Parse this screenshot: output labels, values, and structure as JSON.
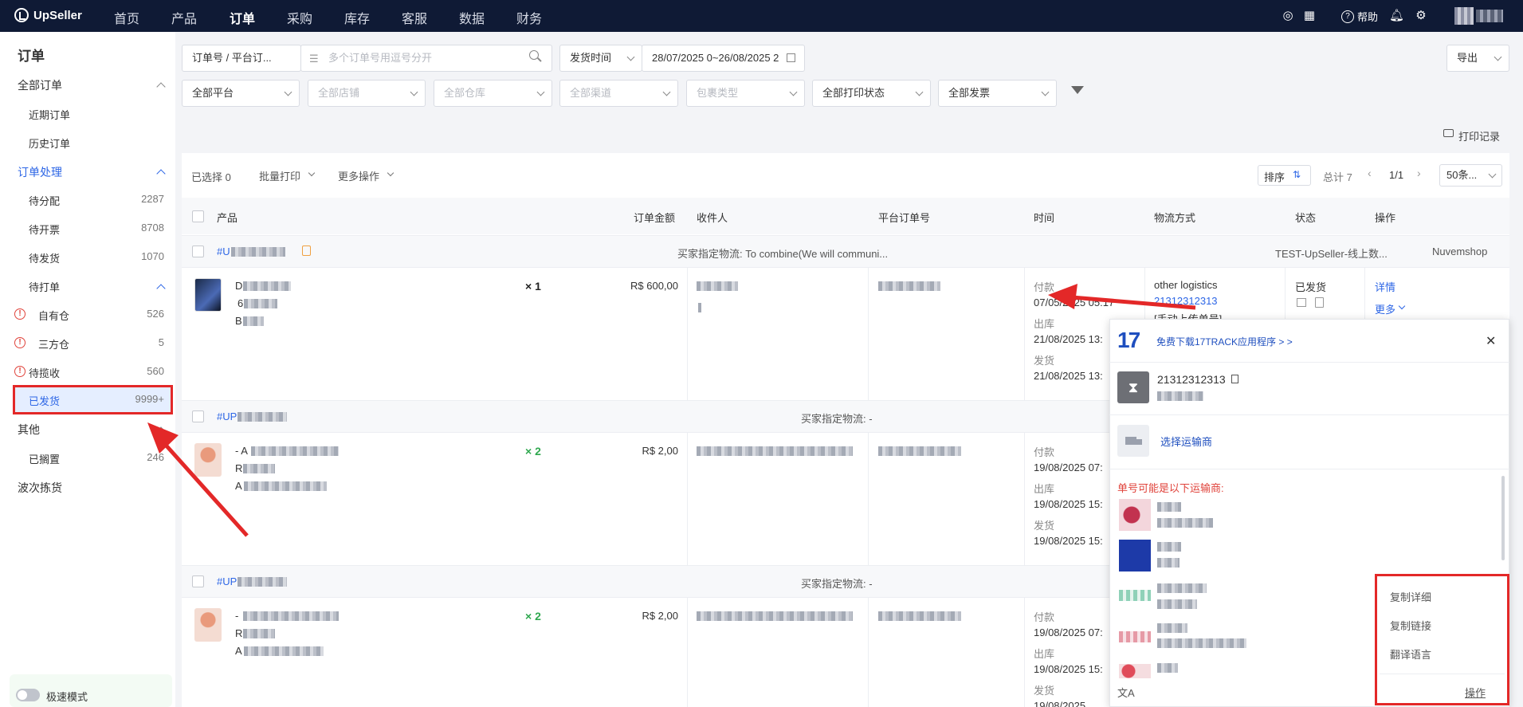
{
  "app": {
    "name": "UpSeller"
  },
  "nav": {
    "items": [
      "首页",
      "产品",
      "订单",
      "采购",
      "库存",
      "客服",
      "数据",
      "财务"
    ],
    "active": "订单",
    "help_label": "帮助"
  },
  "sidebar": {
    "title": "订单",
    "all_orders": "全部订单",
    "recent_orders": "近期订单",
    "history_orders": "历史订单",
    "processing": "订单处理",
    "pending_assign": {
      "label": "待分配",
      "count": "2287"
    },
    "pending_invoice": {
      "label": "待开票",
      "count": "8708"
    },
    "pending_ship": {
      "label": "待发货",
      "count": "1070"
    },
    "pending_print": "待打单",
    "own_warehouse": {
      "label": "自有仓",
      "count": "526"
    },
    "third_warehouse": {
      "label": "三方仓",
      "count": "5"
    },
    "pending_pickup": {
      "label": "待揽收",
      "count": "560"
    },
    "shipped": {
      "label": "已发货",
      "count": "9999+"
    },
    "other": "其他",
    "shelved": {
      "label": "已搁置",
      "count": "246"
    },
    "wave_picking": "波次拣货",
    "speed_mode": "极速模式"
  },
  "filters": {
    "order_type": "订单号 / 平台订...",
    "order_placeholder": "多个订单号用逗号分开",
    "time_type": "发货时间",
    "date_range": "28/07/2025 0~26/08/2025 2",
    "export": "导出",
    "platform": "全部平台",
    "shop": "全部店铺",
    "warehouse": "全部仓库",
    "channel": "全部渠道",
    "package_type": "包裹类型",
    "print_status": "全部打印状态",
    "invoice": "全部发票",
    "print_record": "打印记录"
  },
  "toolbar": {
    "selected": "已选择 0",
    "batch_print": "批量打印",
    "more_ops": "更多操作",
    "sort": "排序",
    "total": "总计 7",
    "page": "1/1",
    "page_size": "50条..."
  },
  "table": {
    "headers": [
      "产品",
      "订单金额",
      "收件人",
      "平台订单号",
      "时间",
      "物流方式",
      "状态",
      "操作"
    ]
  },
  "orders": [
    {
      "order_no": "#U",
      "buyer_logistics": "买家指定物流: To combine(We will communi...",
      "store": "TEST-UpSeller-线上数...",
      "platform": "Nuvemshop",
      "product_prefix": [
        "D",
        "6",
        "B"
      ],
      "qty": "× 1",
      "amount": "R$ 600,00",
      "pay_label": "付款",
      "pay_time": "07/05/2025 05:17",
      "out_label": "出库",
      "out_time": "21/08/2025 13:",
      "ship_label": "发货",
      "ship_time": "21/08/2025 13:",
      "logistics": "other logistics",
      "tracking": "21312312313",
      "manual": "[手动上传单号]",
      "status": "已发货",
      "detail": "详情",
      "more": "更多"
    },
    {
      "order_no": "#UP",
      "buyer_logistics": "买家指定物流: -",
      "product_prefix": [
        "- A",
        "R",
        "A"
      ],
      "qty": "× 2",
      "amount": "R$ 2,00",
      "pay_label": "付款",
      "pay_time": "19/08/2025 07:",
      "out_label": "出库",
      "out_time": "19/08/2025 15:",
      "ship_label": "发货",
      "ship_time": "19/08/2025 15:"
    },
    {
      "order_no": "#UP",
      "buyer_logistics": "买家指定物流: -",
      "product_prefix": [
        "-",
        "R",
        "A"
      ],
      "qty": "× 2",
      "amount": "R$ 2,00",
      "pay_label": "付款",
      "pay_time": "19/08/2025 07:",
      "out_label": "出库",
      "out_time": "19/08/2025 15:",
      "ship_label": "发货",
      "ship_time": "19/08/2025"
    }
  ],
  "popup": {
    "download": "免费下载17TRACK应用程序 > >",
    "tracking": "21312312313",
    "select_carrier": "选择运输商",
    "maybe": "单号可能是以下运输商:",
    "menu": [
      "复制详细",
      "复制链接",
      "翻译语言"
    ],
    "op": "操作"
  },
  "colors": {
    "accent": "#2d66e6",
    "topbar": "#0f1a35",
    "highlight": "#e32828",
    "qty_green": "#2fa84f"
  }
}
